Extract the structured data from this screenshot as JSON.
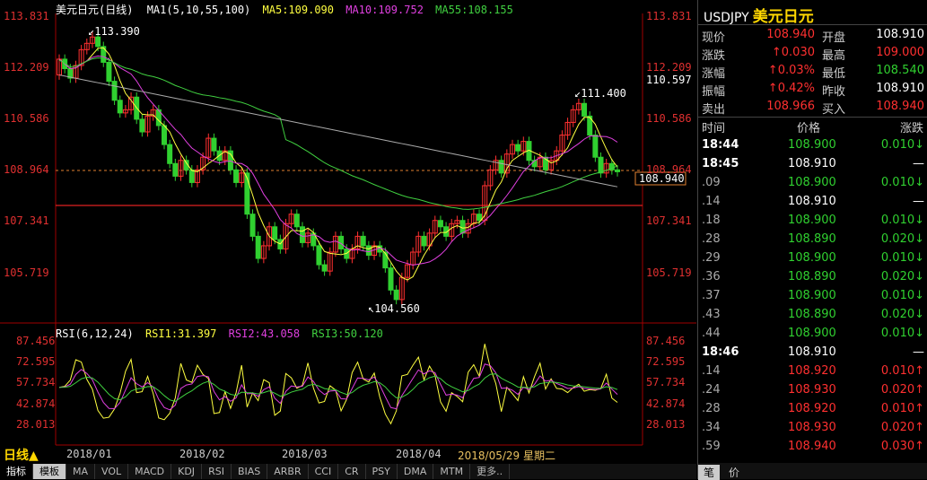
{
  "chart": {
    "title": "美元日元(日线)",
    "ma_label": "MA1(5,10,55,100)",
    "ma5": "MA5:109.090",
    "ma10": "MA10:109.752",
    "ma55": "MA55:108.155",
    "y_axis_left": [
      "113.831",
      "112.209",
      "110.586",
      "108.964",
      "107.341",
      "105.719"
    ],
    "y_axis_right": [
      "113.831",
      "112.209",
      "110.597",
      "110.586",
      "108.964",
      "107.341",
      "105.719"
    ],
    "current_price_box": "108.940",
    "high_marker": "113.390",
    "low_marker": "104.560",
    "recent_high_marker": "111.400",
    "rsi_label": "RSI(6,12,24)",
    "rsi1": "RSI1:31.397",
    "rsi2": "RSI2:43.058",
    "rsi3": "RSI3:50.120",
    "rsi_axis": [
      "87.456",
      "72.595",
      "57.734",
      "42.874",
      "28.013"
    ],
    "period": "日线",
    "dates": [
      "2018/01",
      "2018/02",
      "2018/03",
      "2018/04"
    ],
    "extra_date": "2018/05/29  星期二",
    "colors": {
      "ma5": "#ffff40",
      "ma10": "#e040e0",
      "ma55": "#40d040",
      "ma100": "#aaaaaa",
      "up": "#ff3030",
      "down": "#30d030"
    }
  },
  "tabs": [
    "指标",
    "模板",
    "MA",
    "VOL",
    "MACD",
    "KDJ",
    "RSI",
    "BIAS",
    "ARBR",
    "CCI",
    "CR",
    "PSY",
    "DMA",
    "MTM",
    "更多.."
  ],
  "quote": {
    "symbol": "USDJPY",
    "name": "美元日元",
    "rows": [
      {
        "l1": "现价",
        "v1": "108.940",
        "c1": "red",
        "l2": "开盘",
        "v2": "108.910",
        "c2": "white"
      },
      {
        "l1": "涨跌",
        "v1": "↑0.030",
        "c1": "red",
        "l2": "最高",
        "v2": "109.000",
        "c2": "red"
      },
      {
        "l1": "涨幅",
        "v1": "↑0.03%",
        "c1": "red",
        "l2": "最低",
        "v2": "108.540",
        "c2": "green"
      },
      {
        "l1": "振幅",
        "v1": "↑0.42%",
        "c1": "red",
        "l2": "昨收",
        "v2": "108.910",
        "c2": "white"
      },
      {
        "l1": "卖出",
        "v1": "108.966",
        "c1": "red",
        "l2": "买入",
        "v2": "108.940",
        "c2": "red"
      }
    ]
  },
  "ticks": {
    "headers": [
      "时间",
      "价格",
      "涨跌"
    ],
    "rows": [
      {
        "t": "18:44",
        "p": "108.900",
        "pc": "green",
        "c": "0.010↓",
        "cc": "green"
      },
      {
        "t": "18:45",
        "p": "108.910",
        "pc": "white",
        "c": "—",
        "cc": "white"
      },
      {
        "t": ".09",
        "p": "108.900",
        "pc": "green",
        "c": "0.010↓",
        "cc": "green"
      },
      {
        "t": ".14",
        "p": "108.910",
        "pc": "white",
        "c": "—",
        "cc": "white"
      },
      {
        "t": ".18",
        "p": "108.900",
        "pc": "green",
        "c": "0.010↓",
        "cc": "green"
      },
      {
        "t": ".28",
        "p": "108.890",
        "pc": "green",
        "c": "0.020↓",
        "cc": "green"
      },
      {
        "t": ".29",
        "p": "108.900",
        "pc": "green",
        "c": "0.010↓",
        "cc": "green"
      },
      {
        "t": ".36",
        "p": "108.890",
        "pc": "green",
        "c": "0.020↓",
        "cc": "green"
      },
      {
        "t": ".37",
        "p": "108.900",
        "pc": "green",
        "c": "0.010↓",
        "cc": "green"
      },
      {
        "t": ".43",
        "p": "108.890",
        "pc": "green",
        "c": "0.020↓",
        "cc": "green"
      },
      {
        "t": ".44",
        "p": "108.900",
        "pc": "green",
        "c": "0.010↓",
        "cc": "green"
      },
      {
        "t": "18:46",
        "p": "108.910",
        "pc": "white",
        "c": "—",
        "cc": "white"
      },
      {
        "t": ".14",
        "p": "108.920",
        "pc": "red",
        "c": "0.010↑",
        "cc": "red"
      },
      {
        "t": ".24",
        "p": "108.930",
        "pc": "red",
        "c": "0.020↑",
        "cc": "red"
      },
      {
        "t": ".28",
        "p": "108.920",
        "pc": "red",
        "c": "0.010↑",
        "cc": "red"
      },
      {
        "t": ".34",
        "p": "108.930",
        "pc": "red",
        "c": "0.020↑",
        "cc": "red"
      },
      {
        "t": ".59",
        "p": "108.940",
        "pc": "red",
        "c": "0.030↑",
        "cc": "red"
      }
    ]
  },
  "bottom_right": [
    "笔",
    "价"
  ]
}
